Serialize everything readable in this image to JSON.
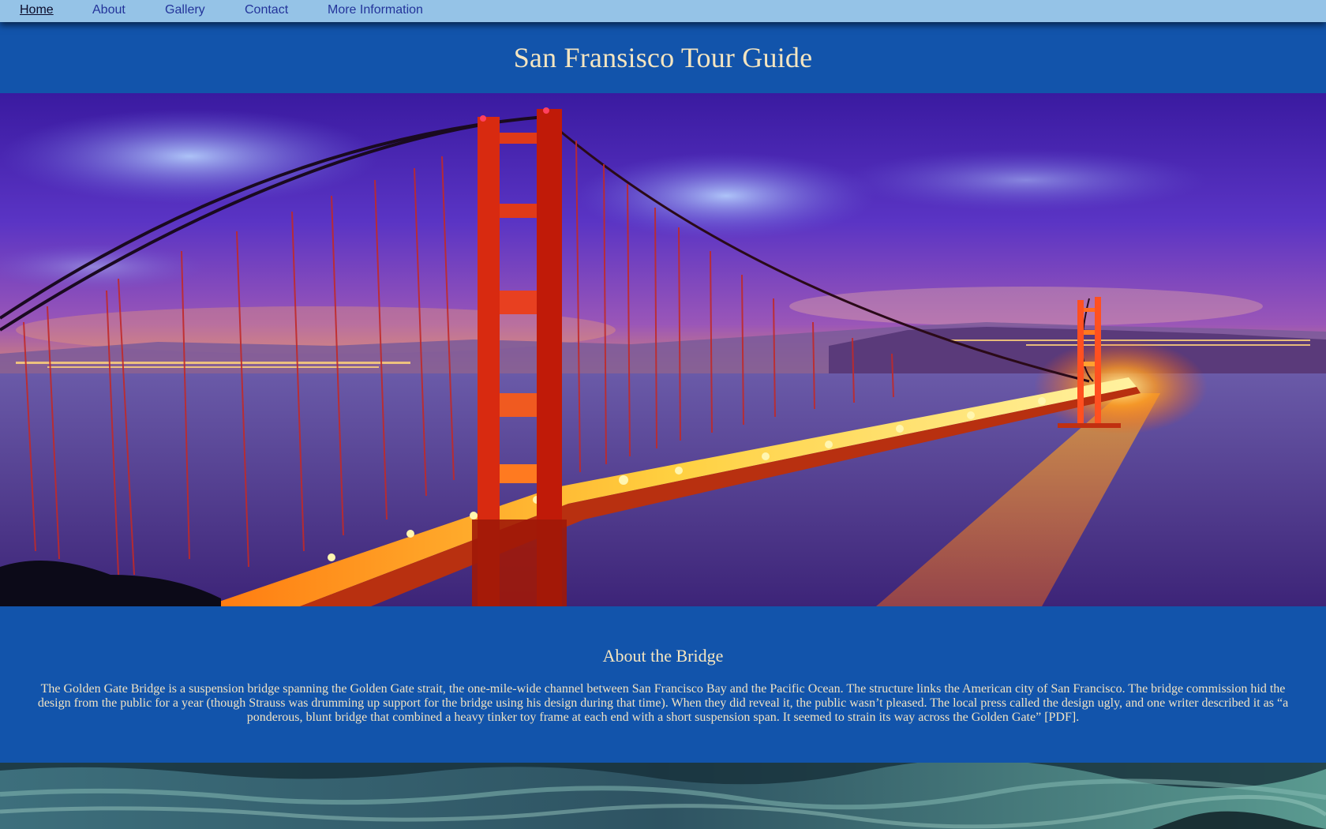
{
  "nav": {
    "items": [
      {
        "label": "Home",
        "active": true
      },
      {
        "label": "About"
      },
      {
        "label": "Gallery"
      },
      {
        "label": "Contact"
      },
      {
        "label": "More Information"
      }
    ]
  },
  "header": {
    "title": "San Fransisco Tour Guide"
  },
  "hero": {
    "image": "golden-gate-bridge-night-photo"
  },
  "about": {
    "heading": "About the Bridge",
    "body": "The Golden Gate Bridge is a suspension bridge spanning the Golden Gate strait, the one-mile-wide channel between San Francisco Bay and the Pacific Ocean. The structure links the American city of San Francisco. The bridge commission hid the design from the public for a year (though Strauss was drumming up support for the bridge using his design during that time). When they did reveal it, the public wasn’t pleased. The local press called the design ugly, and one writer described it as “a ponderous, blunt bridge that combined a heavy tinker toy frame at each end with a short suspension span. It seemed to strain its way across the Golden Gate” [PDF]."
  },
  "footer": {
    "image": "ocean-water-photo"
  },
  "colors": {
    "nav_bg": "#95c3e7",
    "page_bg": "#1254ab",
    "title_text": "#f4e5c0",
    "nav_link": "#23349a"
  }
}
